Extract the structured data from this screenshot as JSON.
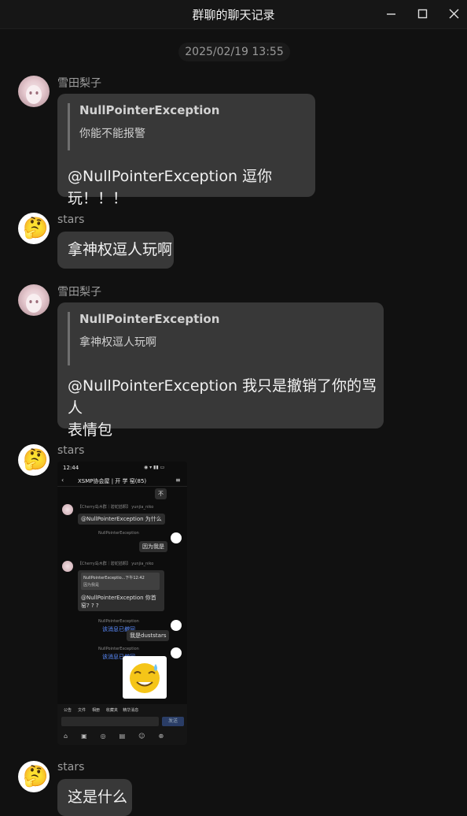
{
  "window": {
    "title": "群聊的聊天记录",
    "minimize_icon": "minimize-icon",
    "maximize_icon": "maximize-icon",
    "close_icon": "close-icon"
  },
  "date_separator": "2025/02/19 13:55",
  "messages": [
    {
      "sender": "雪田梨子",
      "avatar": "anime-girl-avatar",
      "quote_name": "NullPointerException",
      "quote_text": "你能不能报警",
      "text": "@NullPointerException 逗你玩！！！"
    },
    {
      "sender": "stars",
      "avatar": "thinking-face-emoji",
      "text": "拿神权逗人玩啊"
    },
    {
      "sender": "雪田梨子",
      "avatar": "anime-girl-avatar",
      "quote_name": "NullPointerException",
      "quote_text": "拿神权逗人玩啊",
      "text_line1": "@NullPointerException 我只是撤销了你的骂人",
      "text_line2": "表情包"
    },
    {
      "sender": "stars",
      "avatar": "thinking-face-emoji",
      "image": {
        "status_time": "12:44",
        "chat_title": "XSMP协会屋 | 开 学 窑(85)",
        "bubble_not": "不",
        "line1_name": "【Cherry岛木群｜碧蛇插颗】 yunjia_niko",
        "line1_text": "@NullPointerException 为什么",
        "line2_name": "NullPointerException",
        "line2_text": "因为我是",
        "quote_head": "NullPointerExceptio...下午12:42",
        "quote_body": "因为我是",
        "line3_text": "@NullPointerException 你首",
        "line3_text2": "窑? ? ?",
        "recall1": "该消息已撤回",
        "line4_text": "我是duststars",
        "recall2": "该消息已撤回",
        "tools": [
          "公告",
          "文件",
          "相册",
          "收藏夹",
          "精华消息"
        ],
        "send": "发送"
      }
    },
    {
      "sender": "stars",
      "avatar": "thinking-face-emoji",
      "text": "这是什么"
    }
  ]
}
